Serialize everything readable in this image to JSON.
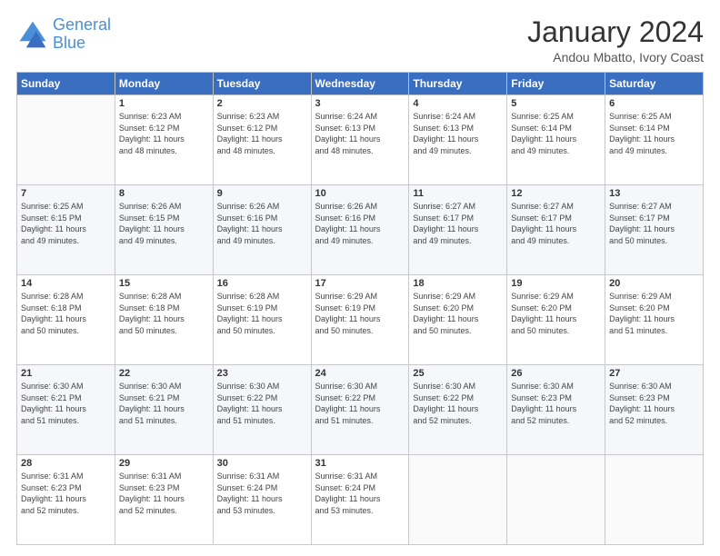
{
  "header": {
    "logo_line1": "General",
    "logo_line2": "Blue",
    "title": "January 2024",
    "subtitle": "Andou Mbatto, Ivory Coast"
  },
  "calendar": {
    "days_of_week": [
      "Sunday",
      "Monday",
      "Tuesday",
      "Wednesday",
      "Thursday",
      "Friday",
      "Saturday"
    ],
    "weeks": [
      [
        {
          "day": "",
          "info": ""
        },
        {
          "day": "1",
          "info": "Sunrise: 6:23 AM\nSunset: 6:12 PM\nDaylight: 11 hours\nand 48 minutes."
        },
        {
          "day": "2",
          "info": "Sunrise: 6:23 AM\nSunset: 6:12 PM\nDaylight: 11 hours\nand 48 minutes."
        },
        {
          "day": "3",
          "info": "Sunrise: 6:24 AM\nSunset: 6:13 PM\nDaylight: 11 hours\nand 48 minutes."
        },
        {
          "day": "4",
          "info": "Sunrise: 6:24 AM\nSunset: 6:13 PM\nDaylight: 11 hours\nand 49 minutes."
        },
        {
          "day": "5",
          "info": "Sunrise: 6:25 AM\nSunset: 6:14 PM\nDaylight: 11 hours\nand 49 minutes."
        },
        {
          "day": "6",
          "info": "Sunrise: 6:25 AM\nSunset: 6:14 PM\nDaylight: 11 hours\nand 49 minutes."
        }
      ],
      [
        {
          "day": "7",
          "info": "Sunrise: 6:25 AM\nSunset: 6:15 PM\nDaylight: 11 hours\nand 49 minutes."
        },
        {
          "day": "8",
          "info": "Sunrise: 6:26 AM\nSunset: 6:15 PM\nDaylight: 11 hours\nand 49 minutes."
        },
        {
          "day": "9",
          "info": "Sunrise: 6:26 AM\nSunset: 6:16 PM\nDaylight: 11 hours\nand 49 minutes."
        },
        {
          "day": "10",
          "info": "Sunrise: 6:26 AM\nSunset: 6:16 PM\nDaylight: 11 hours\nand 49 minutes."
        },
        {
          "day": "11",
          "info": "Sunrise: 6:27 AM\nSunset: 6:17 PM\nDaylight: 11 hours\nand 49 minutes."
        },
        {
          "day": "12",
          "info": "Sunrise: 6:27 AM\nSunset: 6:17 PM\nDaylight: 11 hours\nand 49 minutes."
        },
        {
          "day": "13",
          "info": "Sunrise: 6:27 AM\nSunset: 6:17 PM\nDaylight: 11 hours\nand 50 minutes."
        }
      ],
      [
        {
          "day": "14",
          "info": "Sunrise: 6:28 AM\nSunset: 6:18 PM\nDaylight: 11 hours\nand 50 minutes."
        },
        {
          "day": "15",
          "info": "Sunrise: 6:28 AM\nSunset: 6:18 PM\nDaylight: 11 hours\nand 50 minutes."
        },
        {
          "day": "16",
          "info": "Sunrise: 6:28 AM\nSunset: 6:19 PM\nDaylight: 11 hours\nand 50 minutes."
        },
        {
          "day": "17",
          "info": "Sunrise: 6:29 AM\nSunset: 6:19 PM\nDaylight: 11 hours\nand 50 minutes."
        },
        {
          "day": "18",
          "info": "Sunrise: 6:29 AM\nSunset: 6:20 PM\nDaylight: 11 hours\nand 50 minutes."
        },
        {
          "day": "19",
          "info": "Sunrise: 6:29 AM\nSunset: 6:20 PM\nDaylight: 11 hours\nand 50 minutes."
        },
        {
          "day": "20",
          "info": "Sunrise: 6:29 AM\nSunset: 6:20 PM\nDaylight: 11 hours\nand 51 minutes."
        }
      ],
      [
        {
          "day": "21",
          "info": "Sunrise: 6:30 AM\nSunset: 6:21 PM\nDaylight: 11 hours\nand 51 minutes."
        },
        {
          "day": "22",
          "info": "Sunrise: 6:30 AM\nSunset: 6:21 PM\nDaylight: 11 hours\nand 51 minutes."
        },
        {
          "day": "23",
          "info": "Sunrise: 6:30 AM\nSunset: 6:22 PM\nDaylight: 11 hours\nand 51 minutes."
        },
        {
          "day": "24",
          "info": "Sunrise: 6:30 AM\nSunset: 6:22 PM\nDaylight: 11 hours\nand 51 minutes."
        },
        {
          "day": "25",
          "info": "Sunrise: 6:30 AM\nSunset: 6:22 PM\nDaylight: 11 hours\nand 52 minutes."
        },
        {
          "day": "26",
          "info": "Sunrise: 6:30 AM\nSunset: 6:23 PM\nDaylight: 11 hours\nand 52 minutes."
        },
        {
          "day": "27",
          "info": "Sunrise: 6:30 AM\nSunset: 6:23 PM\nDaylight: 11 hours\nand 52 minutes."
        }
      ],
      [
        {
          "day": "28",
          "info": "Sunrise: 6:31 AM\nSunset: 6:23 PM\nDaylight: 11 hours\nand 52 minutes."
        },
        {
          "day": "29",
          "info": "Sunrise: 6:31 AM\nSunset: 6:23 PM\nDaylight: 11 hours\nand 52 minutes."
        },
        {
          "day": "30",
          "info": "Sunrise: 6:31 AM\nSunset: 6:24 PM\nDaylight: 11 hours\nand 53 minutes."
        },
        {
          "day": "31",
          "info": "Sunrise: 6:31 AM\nSunset: 6:24 PM\nDaylight: 11 hours\nand 53 minutes."
        },
        {
          "day": "",
          "info": ""
        },
        {
          "day": "",
          "info": ""
        },
        {
          "day": "",
          "info": ""
        }
      ]
    ]
  }
}
